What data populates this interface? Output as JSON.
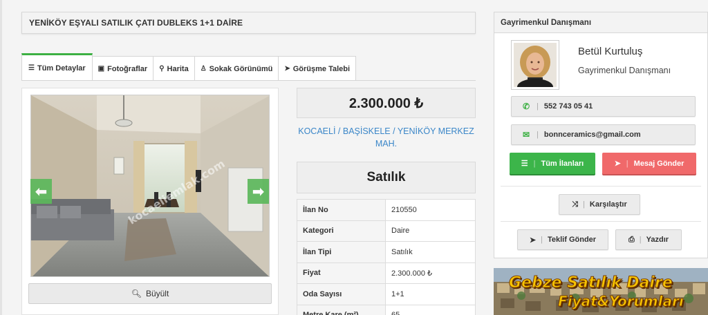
{
  "listing": {
    "title": "YENİKÖY EŞYALI SATILIK ÇATI DUBLEKS 1+1 DAİRE",
    "price": "2.300.000 ₺",
    "location": "KOCAELİ / BAŞİSKELE / YENİKÖY MERKEZ MAH.",
    "status": "Satılık"
  },
  "tabs": [
    {
      "label": "Tüm Detaylar",
      "icon": "list-icon",
      "active": true
    },
    {
      "label": "Fotoğraflar",
      "icon": "image-icon"
    },
    {
      "label": "Harita",
      "icon": "map-marker-icon"
    },
    {
      "label": "Sokak Görünümü",
      "icon": "street-view-icon"
    },
    {
      "label": "Görüşme Talebi",
      "icon": "paper-plane-icon"
    }
  ],
  "gallery": {
    "zoom_label": "Büyült",
    "watermark": "kocaeliemlak.com"
  },
  "details": [
    {
      "key": "İlan No",
      "value": "210550"
    },
    {
      "key": "Kategori",
      "value": "Daire"
    },
    {
      "key": "İlan Tipi",
      "value": "Satılık"
    },
    {
      "key": "Fiyat",
      "value": "2.300.000 ₺"
    },
    {
      "key": "Oda Sayısı",
      "value": "1+1"
    },
    {
      "key": "Metre Kare (m²)",
      "value": "65"
    }
  ],
  "agent": {
    "section_title": "Gayrimenkul Danışmanı",
    "name": "Betül Kurtuluş",
    "title": "Gayrimenkul Danışmanı",
    "phone": "552 743 05 41",
    "email": "bonnceramics@gmail.com",
    "all_listings_label": "Tüm İlanları",
    "send_message_label": "Mesaj Gönder",
    "compare_label": "Karşılaştır",
    "offer_label": "Teklif Gönder",
    "print_label": "Yazdır"
  },
  "banner": {
    "line1": "Gebze Satılık Daire",
    "line2": "Fiyat&Yorumları"
  },
  "colors": {
    "accent_green": "#3cb54a",
    "accent_red": "#f0696a",
    "link_blue": "#3a86c8"
  }
}
